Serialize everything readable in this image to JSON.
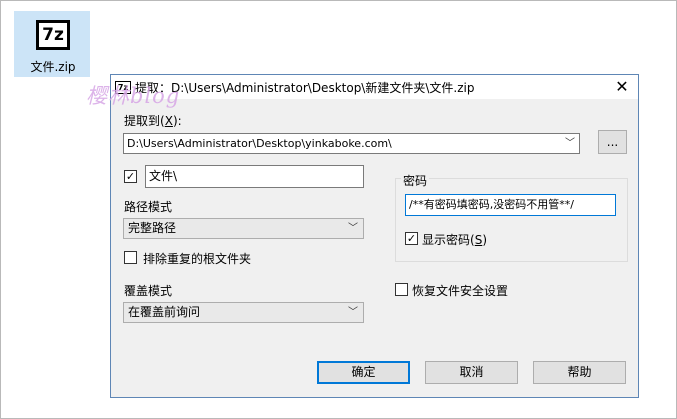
{
  "desktop": {
    "icon_label": "文件.zip",
    "icon_glyph": "7z",
    "watermark": "樱林blog"
  },
  "dialog": {
    "title": "提取：D:\\Users\\Administrator\\Desktop\\新建文件夹\\文件.zip",
    "title_icon": "7z",
    "close_glyph": "✕",
    "extract_to": {
      "label": "提取到",
      "hotkey": "X",
      "value": "D:\\Users\\Administrator\\Desktop\\yinkaboke.com\\",
      "browse_label": "..."
    },
    "subfolder": {
      "checked": "✓",
      "value": "文件\\"
    },
    "path_mode": {
      "label": "路径模式",
      "selected": "完整路径"
    },
    "eliminate_root": {
      "label": "排除重复的根文件夹"
    },
    "overwrite_mode": {
      "label": "覆盖模式",
      "selected": "在覆盖前询问"
    },
    "password": {
      "group_label": "密码",
      "value": "/**有密码填密码,没密码不用管**/",
      "show_label": "显示密码",
      "show_hotkey": "S",
      "show_checked": "✓"
    },
    "restore_security": {
      "label": "恢复文件安全设置"
    },
    "buttons": {
      "ok": "确定",
      "cancel": "取消",
      "help": "帮助"
    }
  }
}
